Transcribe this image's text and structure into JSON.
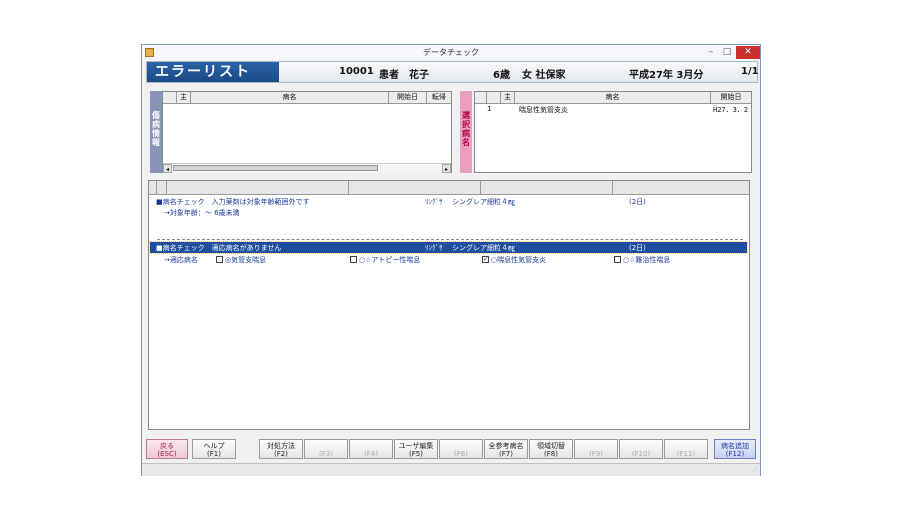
{
  "window": {
    "title": "データチェック",
    "close": "✕",
    "minimize": "–",
    "maximize": "□"
  },
  "header": {
    "title": "エラーリスト",
    "patient_id": "10001",
    "patient_name": "患者　花子",
    "age": "6歳",
    "sex_insurance": "女 社保家",
    "period": "平成27年 3月分",
    "page": "1/1"
  },
  "left_panel": {
    "vlabel": "傷病情報",
    "columns": [
      "主",
      "病名",
      "開始日",
      "転帰"
    ]
  },
  "right_panel": {
    "vlabel": "選択病名",
    "columns": [
      "主",
      "病名",
      "開始日"
    ],
    "rows": [
      {
        "no": "1",
        "main": "",
        "name": "喘息性気管支炎",
        "start": "H27．3．2"
      }
    ]
  },
  "errors": [
    {
      "label": "■病名チェック　入力薬剤は対象年齢範囲外です",
      "kind": "ﾘﾝｸﾞｻ",
      "drug": "シングレア細粒４㎎",
      "days": "(2日)",
      "detail": "→対象年齢：～ 6歳未満"
    },
    {
      "label": "■病名チェック　適応病名がありません",
      "kind": "ﾘﾝｸﾞｻ",
      "drug": "シングレア細粒４㎎",
      "days": "(2日)",
      "detail_prefix": "→適応病名",
      "options": [
        {
          "checked": false,
          "label": "◎気管支喘息"
        },
        {
          "checked": false,
          "label": "○☆アトピー性喘息"
        },
        {
          "checked": true,
          "label": "○喘息性気管支炎"
        },
        {
          "checked": false,
          "label": "○☆難治性喘息"
        }
      ]
    }
  ],
  "fkeys": [
    {
      "label": "戻る",
      "key": "(ESC)",
      "enabled": true
    },
    {
      "label": "ヘルプ",
      "key": "(F1)",
      "enabled": true
    },
    {
      "label": "対処方法",
      "key": "(F2)",
      "enabled": true
    },
    {
      "label": "",
      "key": "(F3)",
      "enabled": false
    },
    {
      "label": "",
      "key": "(F4)",
      "enabled": false
    },
    {
      "label": "ユーザ編集",
      "key": "(F5)",
      "enabled": true
    },
    {
      "label": "",
      "key": "(F6)",
      "enabled": false
    },
    {
      "label": "全参考病名",
      "key": "(F7)",
      "enabled": true
    },
    {
      "label": "領域切替",
      "key": "(F8)",
      "enabled": true
    },
    {
      "label": "",
      "key": "(F9)",
      "enabled": false
    },
    {
      "label": "",
      "key": "(F10)",
      "enabled": false
    },
    {
      "label": "",
      "key": "(F11)",
      "enabled": false
    },
    {
      "label": "病名追加",
      "key": "(F12)",
      "enabled": true
    }
  ]
}
